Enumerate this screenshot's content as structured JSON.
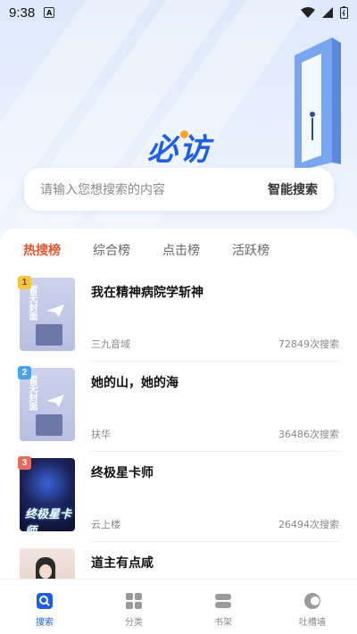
{
  "status_bar": {
    "time": "9:38",
    "badge": "A"
  },
  "hero": {
    "logo": "必访"
  },
  "search": {
    "placeholder": "请输入您想搜索的内容",
    "action": "智能搜索"
  },
  "tabs": [
    {
      "label": "热搜榜",
      "active": true
    },
    {
      "label": "综合榜",
      "active": false
    },
    {
      "label": "点击榜",
      "active": false
    },
    {
      "label": "活跃榜",
      "active": false
    }
  ],
  "books": [
    {
      "rank": "1",
      "title": "我在精神病院学斩神",
      "author": "三九音域",
      "count": "72849次搜索",
      "cover_text": "暂无封面"
    },
    {
      "rank": "2",
      "title": "她的山，她的海",
      "author": "扶华",
      "count": "36486次搜索",
      "cover_text": "暂无封面"
    },
    {
      "rank": "3",
      "title": "终极星卡师",
      "author": "云上楼",
      "count": "26494次搜索",
      "cover_text": "终极星卡师"
    },
    {
      "rank": "",
      "title": "道主有点咸",
      "author": "",
      "count": "",
      "cover_text": ""
    }
  ],
  "nav": [
    {
      "label": "搜索",
      "icon": "search-icon",
      "active": true
    },
    {
      "label": "分类",
      "icon": "category-icon",
      "active": false
    },
    {
      "label": "书架",
      "icon": "bookshelf-icon",
      "active": false
    },
    {
      "label": "吐槽墙",
      "icon": "comment-wall-icon",
      "active": false
    }
  ],
  "colors": {
    "accent": "#1f5fe8",
    "tab_active": "#e8552c",
    "rank1": "#f6c443",
    "rank2": "#4aa3e8",
    "rank3": "#e86a5a"
  }
}
